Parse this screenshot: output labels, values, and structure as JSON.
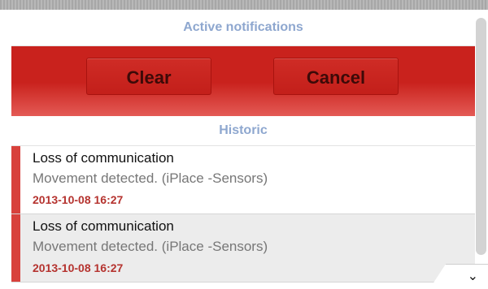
{
  "header": {
    "active_title": "Active notifications",
    "historic_title": "Historic"
  },
  "actions": {
    "clear_label": "Clear",
    "cancel_label": "Cancel"
  },
  "notifications": [
    {
      "title": "Loss of communication",
      "description": "Movement detected. (iPlace -Sensors)",
      "timestamp": "2013-10-08 16:27"
    },
    {
      "title": "Loss of communication",
      "description": "Movement detected. (iPlace -Sensors)",
      "timestamp": "2013-10-08 16:27"
    }
  ],
  "icons": {
    "scroll_down": "chevron-down-icon"
  },
  "colors": {
    "accent_red": "#c9221d",
    "header_blue": "#8ea7cf",
    "timestamp_red": "#b5332f",
    "severity_red": "#d8413c"
  }
}
